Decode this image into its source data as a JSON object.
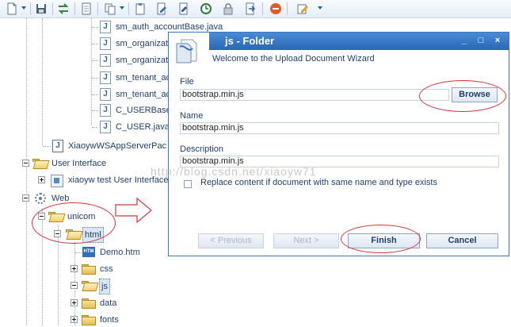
{
  "tree": {
    "java_files": [
      "sm_auth_accountBase.java",
      "sm_organizat",
      "sm_organizat",
      "sm_tenant_ac",
      "sm_tenant_ac",
      "C_USERBase",
      "C_USER.java"
    ],
    "app_server_pack": "XiaoywWSAppServerPac",
    "user_interface": "User Interface",
    "ui_child": "xiaoyw test User Interface",
    "web": "Web",
    "unicom": "unicom",
    "html": "html",
    "demo": "Demo.htm",
    "css": "css",
    "js": "js",
    "data": "data",
    "fonts": "fonts",
    "htm_badge": "HTM",
    "java_badge": "J"
  },
  "dialog": {
    "title": "js - Folder",
    "subtitle": "Welcome to the Upload Document Wizard",
    "file_label": "File",
    "file_value": "bootstrap.min.js",
    "browse": "Browse",
    "name_label": "Name",
    "name_value": "bootstrap.min.js",
    "description_label": "Description",
    "description_value": "bootstrap.min.js",
    "replace_label": "Replace content if document with same name and type exists",
    "prev": "< Previous",
    "next": "Next >",
    "finish": "Finish",
    "cancel": "Cancel",
    "minimize": "_",
    "maximize": "□",
    "close": "×"
  },
  "watermark": "http://blog.csdn.net/xiaoyw71",
  "icons": [
    "new-document-icon",
    "save-icon",
    "refresh-icon",
    "document-icon",
    "copy-icon",
    "paste-icon",
    "edit-document-icon",
    "history-icon",
    "lock-icon",
    "export-icon",
    "stop-icon",
    "edit-icon"
  ],
  "colors": {
    "accent": "#2a66b4",
    "annotation": "#d9343a"
  }
}
